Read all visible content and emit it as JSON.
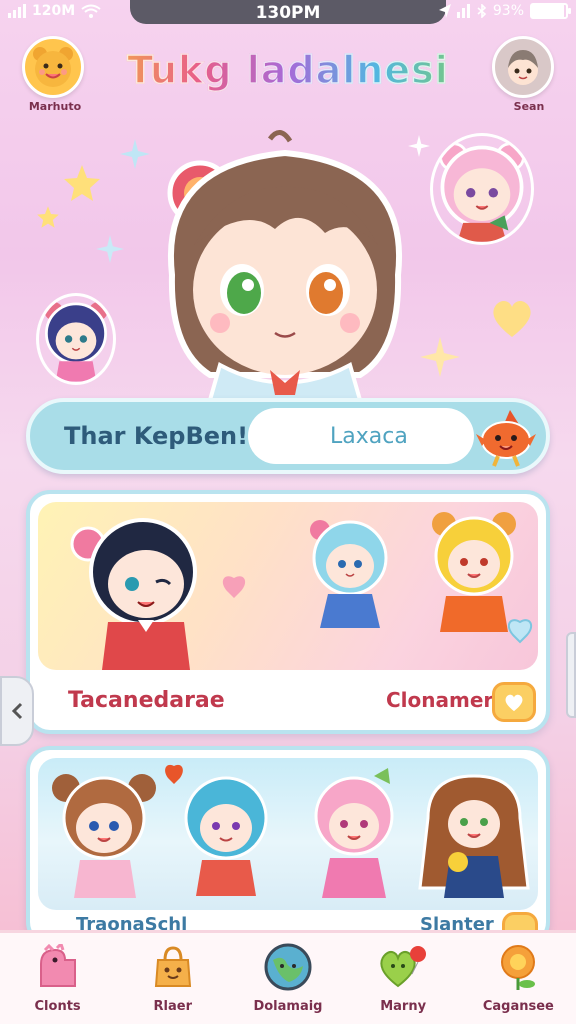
{
  "status_bar": {
    "left_text": "120M",
    "time": "130PM",
    "battery_text": "93%",
    "battery_level": 0.93
  },
  "header": {
    "title": "Tukg ladalnesi",
    "left_avatar_label": "Marhuto",
    "right_avatar_label": "Sean"
  },
  "search": {
    "label": "Thar KepBen!",
    "placeholder": "Laxaca"
  },
  "cards": [
    {
      "label_left": "Tacanedarae",
      "label_right": "Clonamer"
    },
    {
      "label_left": "TraonaSchl",
      "label_right": "Slanter"
    }
  ],
  "bottom_nav": [
    {
      "label": "Clonts",
      "icon": "dino-icon"
    },
    {
      "label": "Rlaer",
      "icon": "bag-icon"
    },
    {
      "label": "Dolamaig",
      "icon": "globe-icon"
    },
    {
      "label": "Marny",
      "icon": "heart-balloon-icon"
    },
    {
      "label": "Cagansee",
      "icon": "flower-icon"
    }
  ],
  "colors": {
    "accent_pink": "#e85f8a",
    "search_bg": "#a9dde8",
    "card_border": "#b9e3ef",
    "label_red": "#c0394d"
  }
}
